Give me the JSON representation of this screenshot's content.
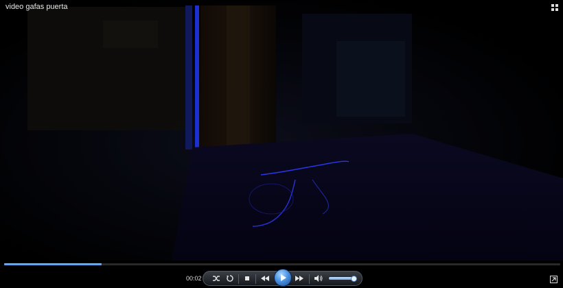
{
  "window": {
    "title": "video gafas puerta"
  },
  "player": {
    "current_time": "00:02",
    "progress": 0.175,
    "volume": 0.9,
    "colors": {
      "accent": "#3b7fd8",
      "background": "#000000"
    }
  },
  "controls": {
    "shuffle": "shuffle-icon",
    "repeat": "repeat-icon",
    "stop": "stop-icon",
    "previous": "previous-icon",
    "play": "play-icon",
    "next": "next-icon",
    "mute": "speaker-icon"
  }
}
